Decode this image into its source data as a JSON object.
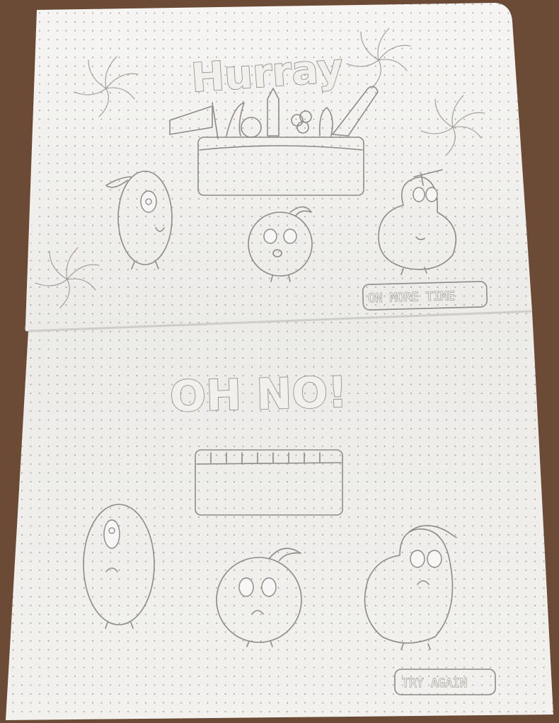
{
  "top_page": {
    "title": "Hurray",
    "button_label": "ON MORE TIME"
  },
  "bottom_page": {
    "title": "OH NO!",
    "button_label": "TRY AGAIN"
  },
  "colors": {
    "background": "#6b4a36",
    "paper": "#f3f2f0",
    "pencil": "#8d8b88",
    "dots": "#555555"
  }
}
